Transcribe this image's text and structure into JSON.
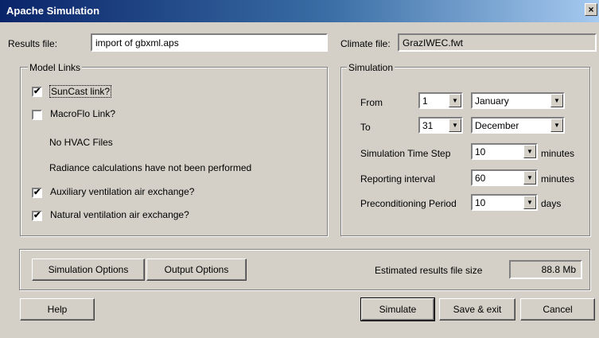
{
  "window": {
    "title": "Apache Simulation",
    "close_glyph": "×"
  },
  "results_file": {
    "label": "Results file:",
    "value": "import of gbxml.aps"
  },
  "climate_file": {
    "label": "Climate file:",
    "value": "GrazIWEC.fwt"
  },
  "model_links": {
    "title": "Model Links",
    "suncast": {
      "label": "SunCast link?",
      "checked": true
    },
    "macroflo": {
      "label": "MacroFlo Link?",
      "checked": false
    },
    "hvac_note": "No HVAC Files",
    "radiance_note": "Radiance calculations have not been performed",
    "aux_vent": {
      "label": "Auxiliary ventilation air exchange?",
      "checked": true
    },
    "nat_vent": {
      "label": "Natural ventilation air exchange?",
      "checked": true
    }
  },
  "simulation": {
    "title": "Simulation",
    "from_label": "From",
    "from_day": "1",
    "from_month": "January",
    "to_label": "To",
    "to_day": "31",
    "to_month": "December",
    "timestep_label": "Simulation Time Step",
    "timestep_value": "10",
    "timestep_unit": "minutes",
    "reporting_label": "Reporting interval",
    "reporting_value": "60",
    "reporting_unit": "minutes",
    "precond_label": "Preconditioning Period",
    "precond_value": "10",
    "precond_unit": "days"
  },
  "options": {
    "simulation_options": "Simulation Options",
    "output_options": "Output Options",
    "est_size_label": "Estimated results file size",
    "est_size_value": "88.8 Mb"
  },
  "footer": {
    "help": "Help",
    "simulate": "Simulate",
    "save_exit": "Save & exit",
    "cancel": "Cancel"
  },
  "glyphs": {
    "check": "✔",
    "dropdown": "▼"
  }
}
